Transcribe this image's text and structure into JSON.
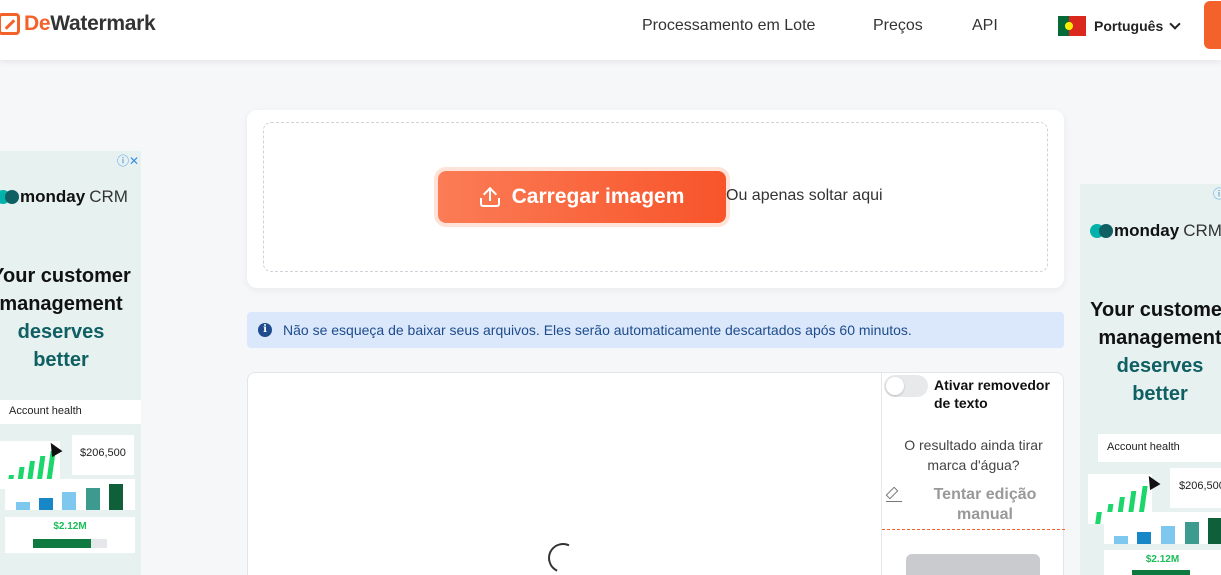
{
  "header": {
    "logo_prefix": "De",
    "logo_suffix": "Watermark",
    "nav": [
      {
        "label": "Processamento em Lote"
      },
      {
        "label": "Preços"
      },
      {
        "label": "API"
      }
    ],
    "language": "Português"
  },
  "ads": {
    "brand_bold": "monday",
    "brand_light": "CRM",
    "headline_line1": "Your customer",
    "headline_line2": "management",
    "headline_line3": "deserves",
    "headline_line4": "better",
    "card_title": "Account health",
    "amount": "$206,500",
    "amount2": "$2.12M",
    "colors": {
      "teal": "#0f5f63",
      "green": "#1bd66a",
      "bg": "#e6f1f0"
    }
  },
  "upload": {
    "button_label": "Carregar imagem",
    "drop_text": "Ou apenas soltar aqui"
  },
  "notice": {
    "text": "Não se esqueça de baixar seus arquivos. Eles serão automaticamente descartados após 60 minutos."
  },
  "result": {
    "toggle_label": "Ativar removedor de texto",
    "question": "O resultado ainda tirar marca d'água?",
    "manual_edit": "Tentar edição manual"
  },
  "colors": {
    "accent": "#f4622c",
    "notice_bg": "#dbe8fb",
    "notice_text": "#1e4c8c"
  }
}
